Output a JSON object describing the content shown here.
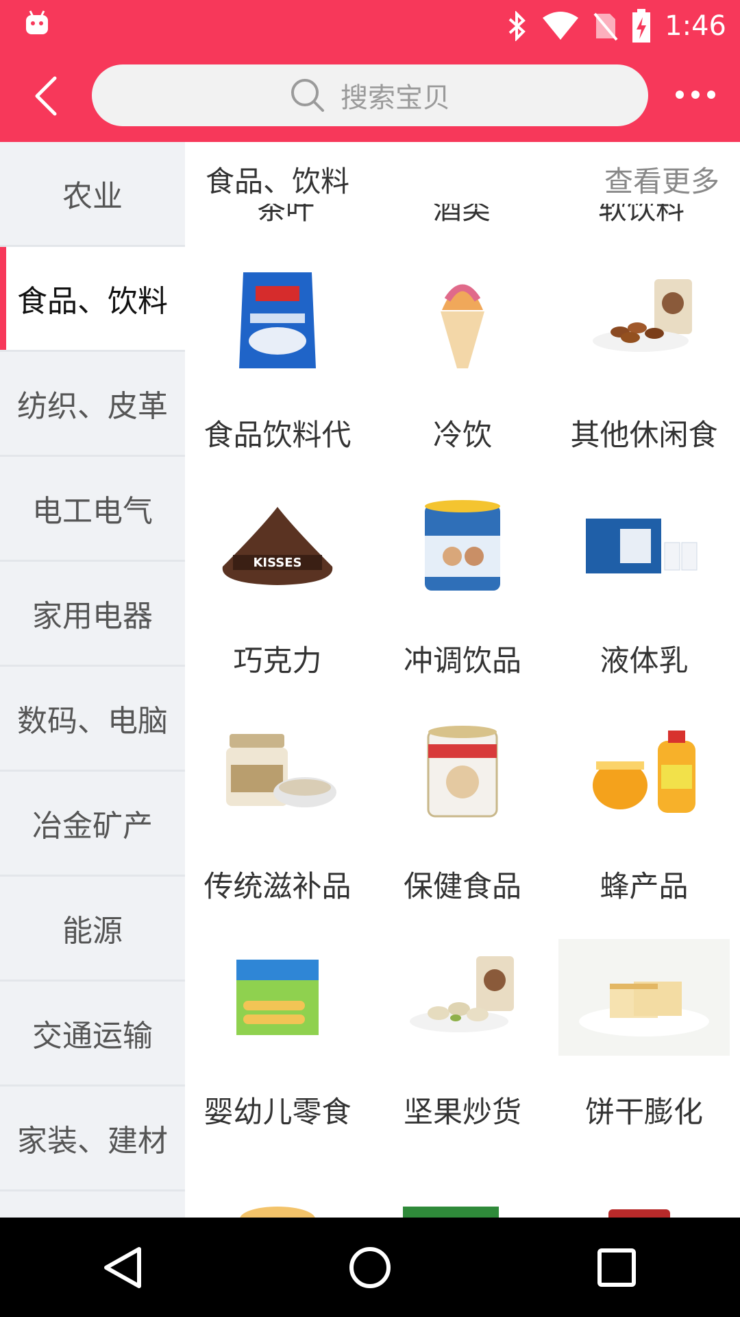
{
  "status_bar": {
    "time": "1:46",
    "icons": [
      "android-icon",
      "bluetooth-icon",
      "wifi-icon",
      "no-sim-icon",
      "battery-charging-icon"
    ]
  },
  "header": {
    "search_placeholder": "搜索宝贝",
    "back_icon": "chevron-left-icon",
    "more_icon": "more-horizontal-icon",
    "accent_color": "#f7385a"
  },
  "sidebar": {
    "items": [
      {
        "label": "农业",
        "active": false
      },
      {
        "label": "食品、饮料",
        "active": true
      },
      {
        "label": "纺织、皮革",
        "active": false
      },
      {
        "label": "电工电气",
        "active": false
      },
      {
        "label": "家用电器",
        "active": false
      },
      {
        "label": "数码、电脑",
        "active": false
      },
      {
        "label": "冶金矿产",
        "active": false
      },
      {
        "label": "能源",
        "active": false
      },
      {
        "label": "交通运输",
        "active": false
      },
      {
        "label": "家装、建材",
        "active": false
      }
    ]
  },
  "section": {
    "title": "食品、饮料",
    "more_label": "查看更多",
    "cut_off_labels": [
      "茶叶",
      "酒类",
      "软饮料"
    ]
  },
  "grid": {
    "rows": [
      [
        {
          "label": "食品饮料代",
          "image": "oat-bag-image"
        },
        {
          "label": "冷饮",
          "image": "ice-cream-image"
        },
        {
          "label": "其他休闲食",
          "image": "nuts-bowl-image"
        }
      ],
      [
        {
          "label": "巧克力",
          "image": "kisses-chocolate-image"
        },
        {
          "label": "冲调饮品",
          "image": "milk-powder-can-image"
        },
        {
          "label": "液体乳",
          "image": "milk-box-image"
        }
      ],
      [
        {
          "label": "传统滋补品",
          "image": "birdnest-jar-image"
        },
        {
          "label": "保健食品",
          "image": "protein-powder-can-image"
        },
        {
          "label": "蜂产品",
          "image": "honey-image"
        }
      ],
      [
        {
          "label": "婴幼儿零食",
          "image": "baby-snack-box-image"
        },
        {
          "label": "坚果炒货",
          "image": "pistachio-image"
        },
        {
          "label": "饼干膨化",
          "image": "bread-plate-image"
        }
      ]
    ]
  },
  "navbar": {
    "buttons": [
      "back-triangle-icon",
      "home-circle-icon",
      "recents-square-icon"
    ]
  }
}
